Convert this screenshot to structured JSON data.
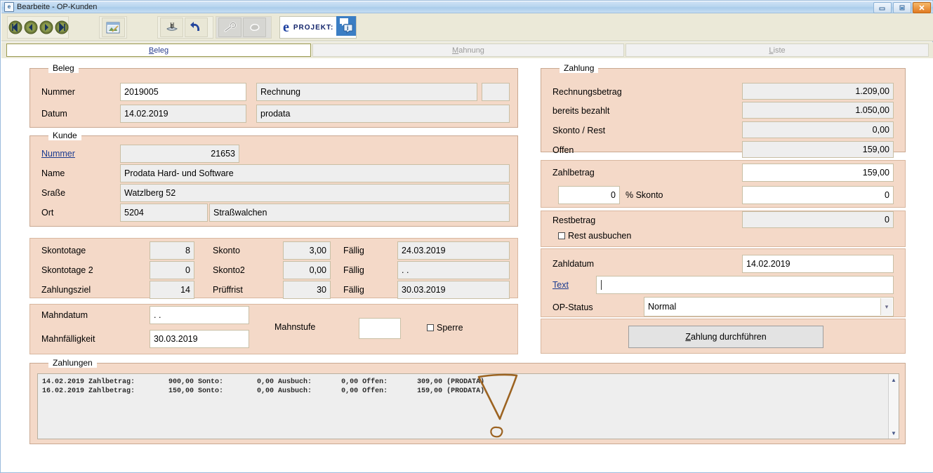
{
  "window": {
    "title": "Bearbeite - OP-Kunden",
    "icon": "app-icon",
    "minimize": "minimize-icon",
    "maximize": "maximize-icon",
    "close": "close-icon"
  },
  "toolbar": {
    "nav_first": "first-record-icon",
    "nav_prev": "previous-record-icon",
    "nav_next": "next-record-icon",
    "nav_last": "last-record-icon",
    "preview": "preview-window-icon",
    "save": "save-icon",
    "undo": "undo-icon",
    "search": "key-search-icon",
    "filter": "filter-icon",
    "brand_e": "e",
    "brand_text": "PROJEKT:",
    "brand_logo": "eprojekt-logo-icon"
  },
  "tabs": [
    {
      "label": "Beleg",
      "accel": "B",
      "active": true
    },
    {
      "label": "Mahnung",
      "accel": "M",
      "active": false
    },
    {
      "label": "Liste",
      "accel": "L",
      "active": false
    }
  ],
  "beleg": {
    "legend": "Beleg",
    "nummer_label": "Nummer",
    "nummer_value": "2019005",
    "art_value": "Rechnung",
    "art_extra": "",
    "datum_label": "Datum",
    "datum_value": "14.02.2019",
    "mandant_value": "prodata"
  },
  "kunde": {
    "legend": "Kunde",
    "nummer_label": "Nummer",
    "nummer_value": "21653",
    "name_label": "Name",
    "name_value": "Prodata Hard- und Software",
    "strasse_label": "Sraße",
    "strasse_value": "Watzlberg 52",
    "ort_label": "Ort",
    "plz_value": "5204",
    "ort_value": "Straßwalchen"
  },
  "konditionen": {
    "skontotage_label": "Skontotage",
    "skontotage_value": "8",
    "skonto_label": "Skonto",
    "skonto_value": "3,00",
    "faellig1_label": "Fällig",
    "faellig1_value": "24.03.2019",
    "skontotage2_label": "Skontotage 2",
    "skontotage2_value": "0",
    "skonto2_label": "Skonto2",
    "skonto2_value": "0,00",
    "faellig2_label": "Fällig",
    "faellig2_value": ".  .",
    "zahlungsziel_label": "Zahlungsziel",
    "zahlungsziel_value": "14",
    "pruefrist_label": "Prüffrist",
    "pruefrist_value": "30",
    "faellig3_label": "Fällig",
    "faellig3_value": "30.03.2019"
  },
  "mahnung": {
    "mahndatum_label": "Mahndatum",
    "mahndatum_value": ".  .",
    "mahnfaelligkeit_label": "Mahnfälligkeit",
    "mahnfaelligkeit_value": "30.03.2019",
    "mahnstufe_label": "Mahnstufe",
    "mahnstufe_value": "",
    "sperre_label": "Sperre",
    "sperre_checked": false
  },
  "zahlung": {
    "legend": "Zahlung",
    "rechnungsbetrag_label": "Rechnungsbetrag",
    "rechnungsbetrag_value": "1.209,00",
    "bereits_bezahlt_label": "bereits bezahlt",
    "bereits_bezahlt_value": "1.050,00",
    "skonto_rest_label": "Skonto / Rest",
    "skonto_rest_value": "0,00",
    "offen_label": "Offen",
    "offen_value": "159,00",
    "zahlbetrag_label": "Zahlbetrag",
    "zahlbetrag_value": "159,00",
    "prozent_skonto_value": "0",
    "prozent_skonto_label": "% Skonto",
    "skonto_betrag_value": "0",
    "restbetrag_label": "Restbetrag",
    "restbetrag_value": "0",
    "rest_ausbuchen_label": "Rest ausbuchen",
    "rest_ausbuchen_checked": false,
    "zahldatum_label": "Zahldatum",
    "zahldatum_value": "14.02.2019",
    "text_label": "Text",
    "text_value": "",
    "op_status_label": "OP-Status",
    "op_status_value": "Normal",
    "op_status_arrow": "chevron-down-icon",
    "submit_label": "Zahlung durchführen",
    "submit_accel": "Z"
  },
  "zahlungen": {
    "legend": "Zahlungen",
    "rows": [
      "14.02.2019 Zahlbetrag:        900,00 Sonto:        0,00 Ausbuch:       0,00 Offen:       309,00 (PRODATA)",
      "16.02.2019 Zahlbetrag:        150,00 Sonto:        0,00 Ausbuch:       0,00 Offen:       159,00 (PRODATA)"
    ],
    "scroll_up": "scroll-up-arrow-icon",
    "scroll_down": "scroll-down-arrow-icon"
  },
  "annotation": {
    "shape": "hand-drawn-triangle-marker",
    "color": "#9c6321"
  },
  "colors": {
    "panel": "#f4d9c8",
    "titlebar": "#aaccea",
    "toolbar": "#ebe9d8",
    "field": "#eeeeee",
    "link": "#1a3a8f"
  }
}
